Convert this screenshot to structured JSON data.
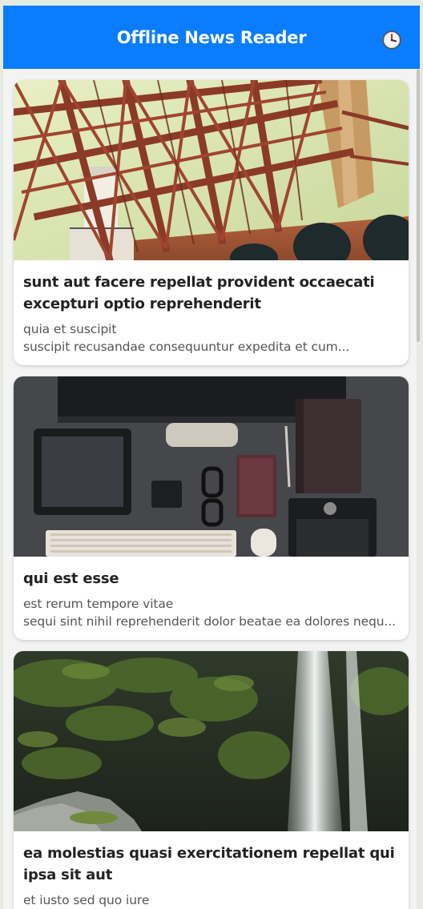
{
  "header": {
    "title": "Offline News Reader",
    "history_icon": "clock-icon"
  },
  "colors": {
    "header_bg": "#0a7cff",
    "page_bg": "#f3f3f3",
    "card_bg": "#ffffff"
  },
  "articles": [
    {
      "title": "sunt aut facere repellat provident occaecati excepturi optio reprehenderit",
      "line1": "quia et suscipit",
      "line2": "suscipit recusandae consequuntur expedita et cum...",
      "image": "bridge-photo"
    },
    {
      "title": "qui est esse",
      "line1": "est rerum tempore vitae",
      "line2": "sequi sint nihil reprehenderit dolor beatae ea dolores nequ...",
      "image": "desk-photo"
    },
    {
      "title": "ea molestias quasi exercitationem repellat qui ipsa sit aut",
      "line1": "et iusto sed quo iure",
      "line2": "",
      "image": "waterfall-photo"
    }
  ]
}
